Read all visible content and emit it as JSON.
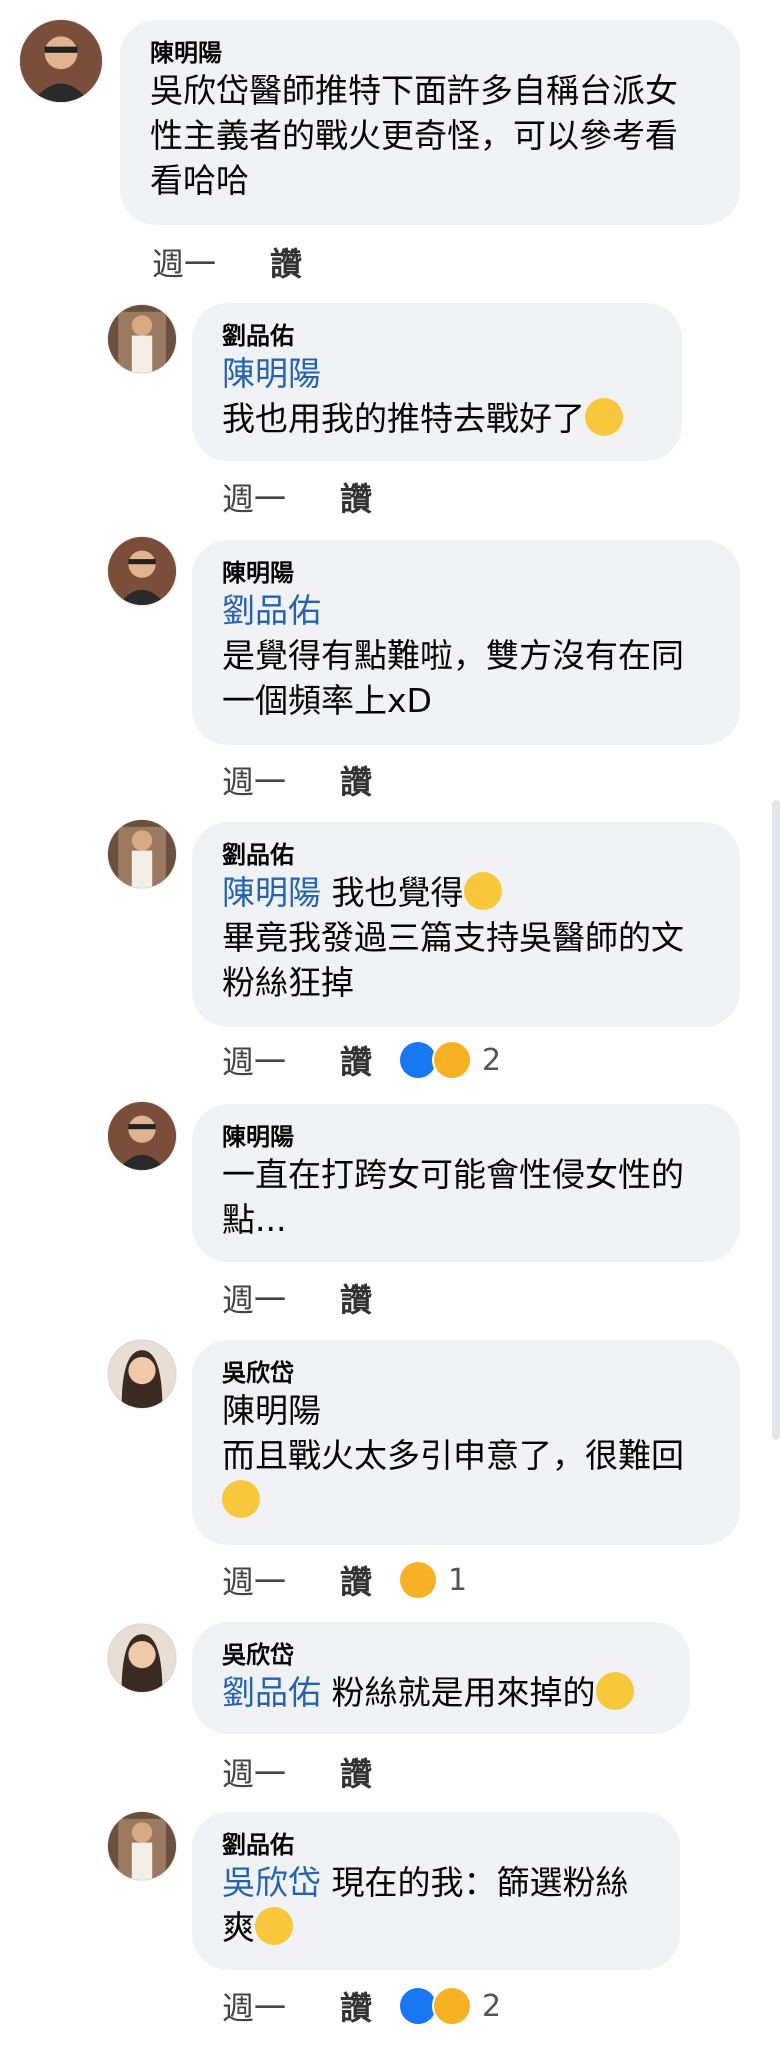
{
  "comments": [
    {
      "author": "陳明陽",
      "lines": [
        {
          "text": "吳欣岱醫師推特下面許多自稱台派女"
        },
        {
          "text": "性主義者的戰火更奇怪，可以參考看"
        },
        {
          "text": "看哈哈"
        }
      ],
      "time": "週一",
      "like": "讚"
    },
    {
      "author": "劉品佑",
      "lines": [
        {
          "mention": "陳明陽"
        },
        {
          "text": "我也用我的推特去戰好了",
          "emoji": "woozy-face"
        }
      ],
      "time": "週一",
      "like": "讚"
    },
    {
      "author": "陳明陽",
      "lines": [
        {
          "mention": "劉品佑"
        },
        {
          "text": "是覺得有點難啦，雙方沒有在同"
        },
        {
          "text": "一個頻率上xD"
        }
      ],
      "time": "週一",
      "like": "讚"
    },
    {
      "author": "劉品佑",
      "lines": [
        {
          "mention": "陳明陽",
          "text": " 我也覺得",
          "emoji": "smiling-tear-face"
        },
        {
          "text": "畢竟我發過三篇支持吳醫師的文"
        },
        {
          "text": "粉絲狂掉"
        }
      ],
      "time": "週一",
      "like": "讚",
      "reactions": [
        "like",
        "care"
      ],
      "reaction_count": "2"
    },
    {
      "author": "陳明陽",
      "lines": [
        {
          "text": "一直在打跨女可能會性侵女性的"
        },
        {
          "text": "點..."
        }
      ],
      "time": "週一",
      "like": "讚"
    },
    {
      "author": "吳欣岱",
      "lines": [
        {
          "text": "陳明陽"
        },
        {
          "text": "而且戰火太多引申意了，很難回"
        },
        {
          "emoji": "tears-of-joy-face"
        }
      ],
      "time": "週一",
      "like": "讚",
      "reactions": [
        "haha"
      ],
      "reaction_count": "1"
    },
    {
      "author": "吳欣岱",
      "lines": [
        {
          "mention": "劉品佑",
          "text": " 粉絲就是用來掉的",
          "emoji": "pleading-face"
        }
      ],
      "time": "週一",
      "like": "讚"
    },
    {
      "author": "劉品佑",
      "lines": [
        {
          "mention": "吳欣岱",
          "text": " 現在的我：篩選粉絲"
        },
        {
          "text": "爽",
          "emoji": "woozy-face"
        }
      ],
      "time": "週一",
      "like": "讚",
      "reactions": [
        "like",
        "haha"
      ],
      "reaction_count": "2"
    }
  ],
  "colors": {
    "mention": "#2563ad",
    "bubble": "#f0f2f5",
    "like_blue": "#1877f2",
    "reaction_yellow": "#f7b125"
  }
}
